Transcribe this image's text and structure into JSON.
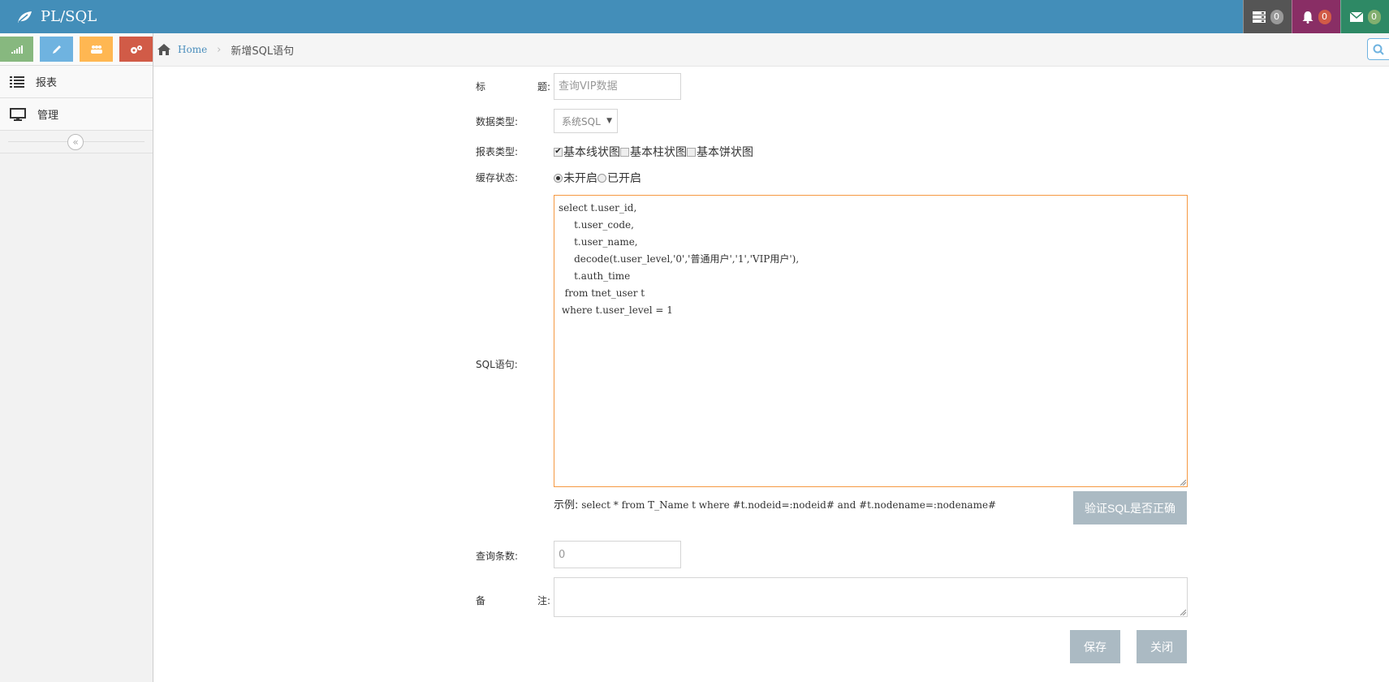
{
  "app": {
    "brand": "PL/SQL"
  },
  "nav": {
    "badges": [
      "0",
      "0",
      "0"
    ]
  },
  "colors": {
    "navbar": "#438eb9",
    "sql_border_focus": "#f59942",
    "button_grey": "#abbac3"
  },
  "sidebar": {
    "items": [
      {
        "label": "报表",
        "icon": "list-icon"
      },
      {
        "label": "管理",
        "icon": "desktop-icon"
      }
    ]
  },
  "breadcrumb": {
    "home": "Home",
    "current": "新增SQL语句"
  },
  "form": {
    "title": {
      "label_a": "标",
      "label_b": "题:",
      "placeholder": "查询VIP数据"
    },
    "data_type": {
      "label": "数据类型:",
      "value": "系统SQL"
    },
    "chart_type": {
      "label": "报表类型:",
      "options": [
        {
          "label": "基本线状图",
          "checked": true
        },
        {
          "label": "基本柱状图",
          "checked": false
        },
        {
          "label": "基本饼状图",
          "checked": false
        }
      ]
    },
    "cache": {
      "label": "缓存状态:",
      "options": [
        {
          "label": "未开启",
          "selected": true
        },
        {
          "label": "已开启",
          "selected": false
        }
      ]
    },
    "sql": {
      "label": "SQL语句:",
      "value": "select t.user_id,\n     t.user_code,\n     t.user_name,\n     decode(t.user_level,'0','普通用户','1','VIP用户'),\n     t.auth_time\n  from tnet_user t\n where t.user_level = 1"
    },
    "example": {
      "prefix": "示例:",
      "code": " select * from T_Name t where #t.nodeid=:nodeid# and #t.nodename=:nodename#"
    },
    "verify_button": "验证SQL是否正确",
    "query_count": {
      "label": "查询条数:",
      "placeholder": "0"
    },
    "notes": {
      "label_a": "备",
      "label_b": "注:"
    },
    "save_button": "保存",
    "close_button": "关闭"
  }
}
